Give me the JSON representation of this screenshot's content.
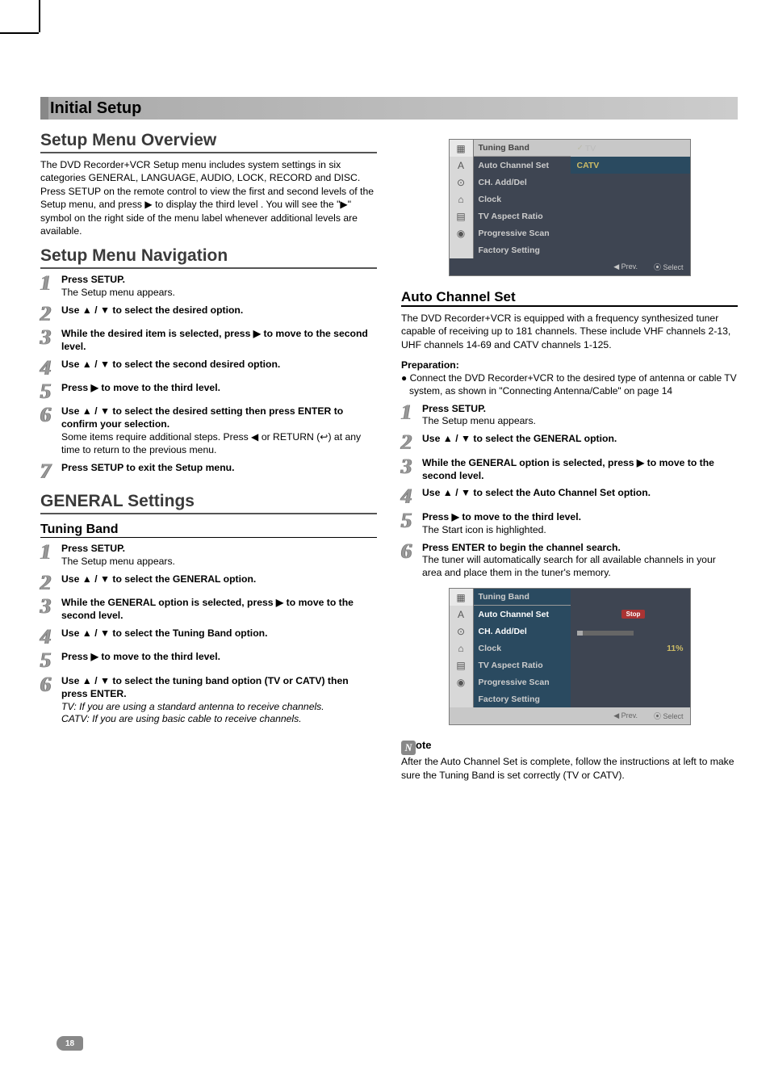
{
  "title_bar": "Initial Setup",
  "left": {
    "overview_heading": "Setup Menu Overview",
    "overview_body": "The DVD Recorder+VCR Setup menu includes system settings in six categories GENERAL, LANGUAGE, AUDIO, LOCK, RECORD and DISC. Press SETUP on the remote control to view the first and second levels of the Setup menu, and press ▶ to display the third level . You will see the \"▶\" symbol on the right side of the menu label whenever additional levels are available.",
    "nav_heading": "Setup Menu Navigation",
    "nav_steps": {
      "s1_b": "Press SETUP.",
      "s1_p": "The Setup menu appears.",
      "s2_b": "Use ▲ / ▼ to select the desired option.",
      "s3_b": "While the desired item is selected, press ▶ to move to the second level.",
      "s4_b": "Use ▲ / ▼ to select the second desired option.",
      "s5_b": "Press ▶ to move to the third level.",
      "s6_b": "Use ▲ / ▼ to select the desired setting then press ENTER to confirm your selection.",
      "s6_p": "Some items require additional steps. Press ◀ or RETURN (↩) at any time to return to the previous menu.",
      "s7_b": "Press SETUP to exit the Setup menu."
    },
    "general_heading": "GENERAL Settings",
    "tuning_sub": "Tuning Band",
    "tuning_steps": {
      "s1_b": "Press SETUP.",
      "s1_p": "The Setup menu appears.",
      "s2_b": "Use ▲ / ▼ to select the GENERAL option.",
      "s3_b": "While the GENERAL option is selected, press ▶ to move to the second level.",
      "s4_b": "Use ▲ / ▼ to select the Tuning Band option.",
      "s5_b": "Press ▶ to move to the third level.",
      "s6_b": "Use ▲ / ▼ to select the tuning band option (TV or CATV) then press ENTER.",
      "s6_i1": "TV: If you are using a standard antenna to receive channels.",
      "s6_i2": "CATV: If you are using basic cable to receive channels."
    }
  },
  "right": {
    "menu1": {
      "header_label": "Tuning Band",
      "header_val": "TV",
      "items": [
        "Auto Channel Set",
        "CH. Add/Del",
        "Clock",
        "TV Aspect Ratio",
        "Progressive Scan",
        "Factory Setting"
      ],
      "val1": "CATV",
      "icons": [
        "▦",
        "A",
        "⊙",
        "⌂",
        "▤",
        "◉"
      ],
      "prev": "◀ Prev.",
      "select": "⦿ Select"
    },
    "auto_heading": "Auto Channel Set",
    "auto_body": "The DVD Recorder+VCR is equipped with a frequency synthesized tuner capable of receiving up to 181 channels. These include VHF channels 2-13, UHF channels 14-69 and CATV channels 1-125.",
    "prep_title": "Preparation:",
    "prep_bullet": "● Connect the DVD Recorder+VCR to the desired type of antenna or cable TV system, as shown in \"Connecting Antenna/Cable\" on page 14",
    "auto_steps": {
      "s1_b": "Press SETUP.",
      "s1_p": "The Setup menu appears.",
      "s2_b": "Use ▲ / ▼ to select the GENERAL option.",
      "s3_b": "While the GENERAL option is selected, press ▶ to move to the second level.",
      "s4_b": "Use ▲ / ▼ to select the Auto Channel Set option.",
      "s5_b": "Press ▶ to move to the third level.",
      "s5_p": "The Start icon is highlighted.",
      "s6_b": "Press ENTER to begin the channel search.",
      "s6_p": "The tuner will automatically search for all available channels in your area and place them in the tuner's memory."
    },
    "menu2": {
      "header_label": "Tuning Band",
      "items": [
        "Auto Channel Set",
        "CH. Add/Del",
        "Clock",
        "TV Aspect Ratio",
        "Progressive Scan",
        "Factory Setting"
      ],
      "stop": "Stop",
      "percent": "11%",
      "prev": "◀ Prev.",
      "select": "⦿ Select"
    },
    "note_label": "ote",
    "note_body": "After the Auto Channel Set is complete, follow the instructions at left to make sure the Tuning Band is set correctly (TV or CATV)."
  },
  "page_number": "18"
}
